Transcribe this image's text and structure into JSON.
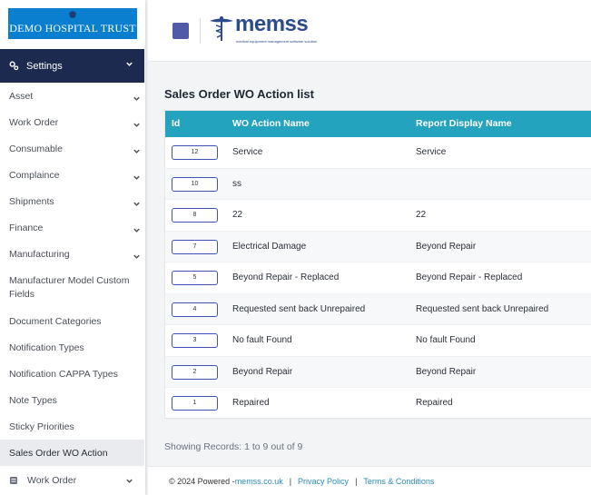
{
  "brand": {
    "name": "DEMO HOSPITAL TRUST"
  },
  "sidebar": {
    "header": {
      "label": "Settings",
      "icon": "settings-icon"
    },
    "items": [
      {
        "label": "Asset",
        "chevron": true
      },
      {
        "label": "Work Order",
        "chevron": true
      },
      {
        "label": "Consumable",
        "chevron": true
      },
      {
        "label": "Complaince",
        "chevron": true
      },
      {
        "label": "Shipments",
        "chevron": true
      },
      {
        "label": "Finance",
        "chevron": true
      },
      {
        "label": "Manufacturing",
        "chevron": true
      },
      {
        "label": "Manufacturer Model Custom Fields",
        "chevron": false
      },
      {
        "label": "Document Categories",
        "chevron": false
      },
      {
        "label": "Notification Types",
        "chevron": false
      },
      {
        "label": "Notification CAPPA Types",
        "chevron": false
      },
      {
        "label": "Note Types",
        "chevron": false
      },
      {
        "label": "Sticky Priorities",
        "chevron": false
      },
      {
        "label": "Sales Order WO Action",
        "chevron": false,
        "active": true
      }
    ],
    "bottom_item": {
      "label": "Work Order",
      "icon": "work-order-icon"
    }
  },
  "topbar": {
    "logo_text": "memss",
    "logo_tagline": "medical equipment management software solution"
  },
  "page": {
    "title": "Sales Order WO Action list"
  },
  "table": {
    "columns": [
      "Id",
      "WO Action Name",
      "Report Display Name"
    ],
    "rows": [
      {
        "id": "12",
        "name": "Service",
        "display": "Service"
      },
      {
        "id": "10",
        "name": "ss",
        "display": ""
      },
      {
        "id": "8",
        "name": "22",
        "display": "22"
      },
      {
        "id": "7",
        "name": "Electrical Damage",
        "display": "Beyond Repair"
      },
      {
        "id": "5",
        "name": "Beyond Repair - Replaced",
        "display": "Beyond Repair - Replaced"
      },
      {
        "id": "4",
        "name": "Requested sent back Unrepaired",
        "display": "Requested sent back Unrepaired"
      },
      {
        "id": "3",
        "name": "No fault Found",
        "display": "No fault Found"
      },
      {
        "id": "2",
        "name": "Beyond Repair",
        "display": "Beyond Repair"
      },
      {
        "id": "1",
        "name": "Repaired",
        "display": "Repaired"
      }
    ]
  },
  "records": {
    "text": "Showing Records: 1 to 9 out of 9"
  },
  "footer": {
    "copyright": "© 2024 Powered - ",
    "link": "memss.co.uk",
    "privacy": "Privacy Policy",
    "terms": "Terms & Conditions",
    "separator": "|"
  },
  "colors": {
    "sidebar_header": "#1c2a4f",
    "table_header": "#23a3bd",
    "brand": "#0a7fcf",
    "accent": "#4f5ba6"
  }
}
